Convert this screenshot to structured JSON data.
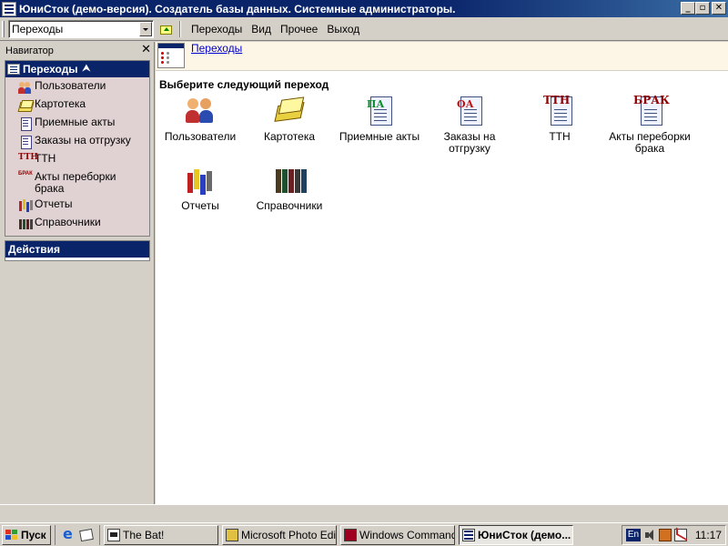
{
  "window": {
    "title": "ЮниСток (демо-версия). Создатель базы данных. Системные администраторы.",
    "controls": {
      "minimize": "_",
      "maximize": "▫",
      "close": "✕"
    }
  },
  "toolbar": {
    "combo_value": "Переходы",
    "menu": [
      "Переходы",
      "Вид",
      "Прочее",
      "Выход"
    ]
  },
  "navigator": {
    "header": "Навигатор",
    "close": "✕",
    "group_title": "Переходы",
    "items": [
      {
        "label": "Пользователи",
        "icon": "users-icon"
      },
      {
        "label": "Картотека",
        "icon": "card-file-icon"
      },
      {
        "label": "Приемные акты",
        "icon": "acceptance-acts-icon"
      },
      {
        "label": "Заказы на отгрузку",
        "icon": "shipping-orders-icon"
      },
      {
        "label": "ТТН",
        "icon": "ttn-icon"
      },
      {
        "label": "Акты переборки брака",
        "icon": "defect-acts-icon"
      },
      {
        "label": "Отчеты",
        "icon": "reports-icon"
      },
      {
        "label": "Справочники",
        "icon": "reference-books-icon"
      }
    ],
    "actions_title": "Действия"
  },
  "main": {
    "breadcrumb": "Переходы",
    "section_title": "Выберите следующий переход",
    "tiles": [
      {
        "label": "Пользователи",
        "badge": ""
      },
      {
        "label": "Картотека",
        "badge": ""
      },
      {
        "label": "Приемные акты",
        "badge": "ПА"
      },
      {
        "label": "Заказы на отгрузку",
        "badge": "ОА"
      },
      {
        "label": "ТТН",
        "badge": "ТТН"
      },
      {
        "label": "Акты переборки брака",
        "badge": "БРАК"
      },
      {
        "label": "Отчеты",
        "badge": ""
      },
      {
        "label": "Справочники",
        "badge": ""
      }
    ]
  },
  "taskbar": {
    "start": "Пуск",
    "tasks": [
      "The Bat!",
      "Microsoft Photo Edi...",
      "Windows Command...",
      "ЮниСток (демо..."
    ],
    "lang": "En",
    "clock": "11:17"
  },
  "colors": {
    "titlebar": "#0a246a",
    "nav_list_bg": "#e0d2d2",
    "breadcrumb_bg": "#fdf5e6",
    "link": "#0000cc"
  }
}
